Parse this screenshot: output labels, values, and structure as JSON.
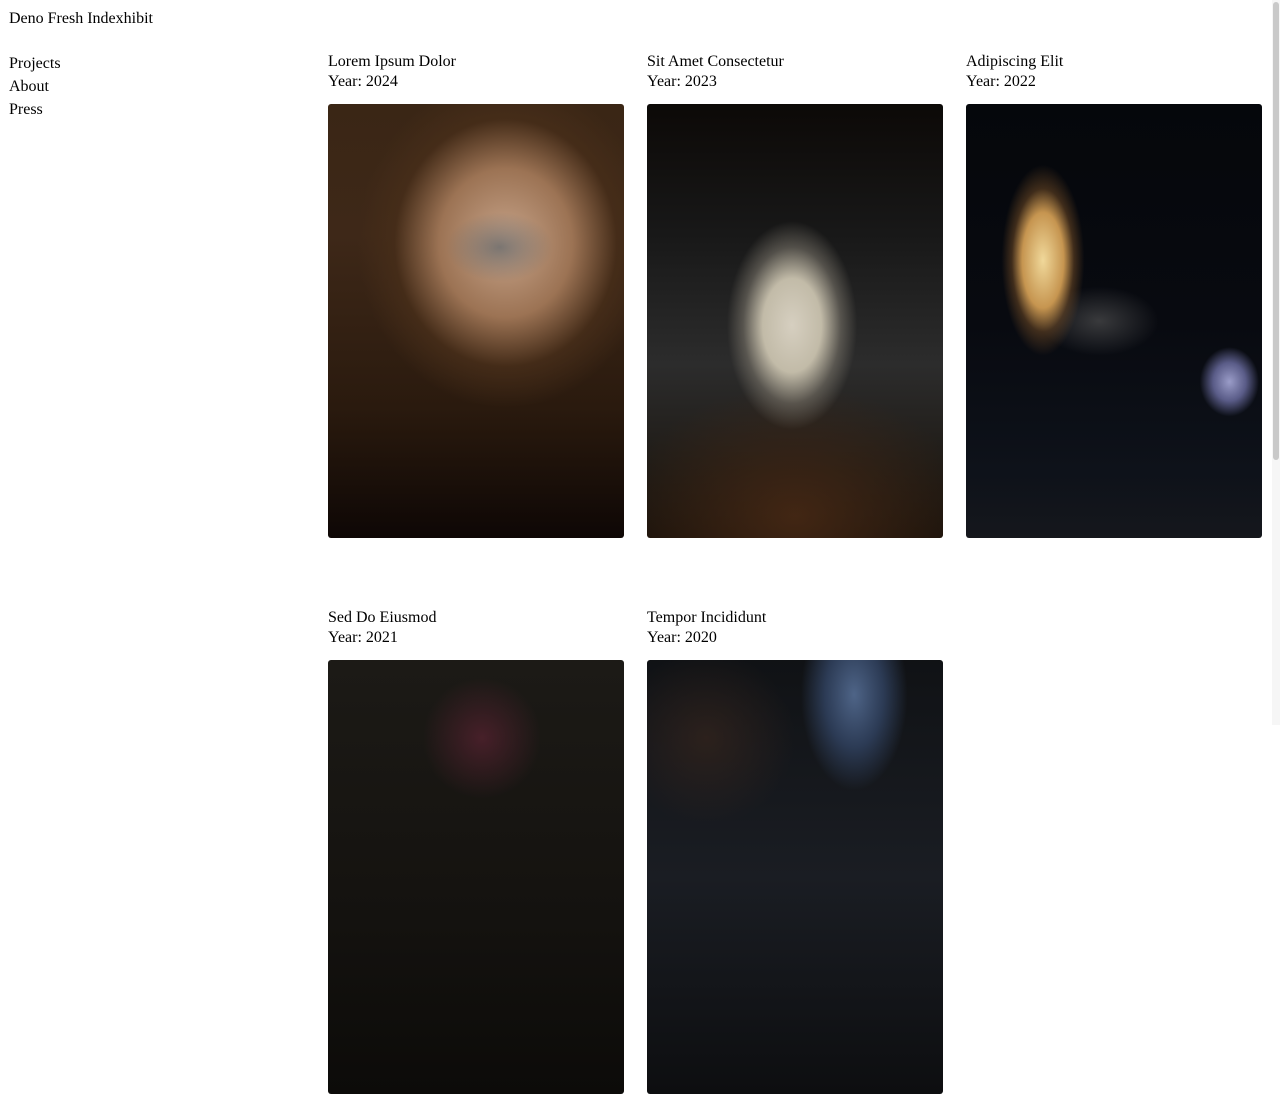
{
  "site": {
    "title": "Deno Fresh Indexhibit"
  },
  "nav": {
    "items": [
      {
        "label": "Projects"
      },
      {
        "label": "About"
      },
      {
        "label": "Press"
      }
    ]
  },
  "projects": [
    {
      "title": "Lorem Ipsum Dolor",
      "year": "Year: 2024"
    },
    {
      "title": "Sit Amet Consectetur",
      "year": "Year: 2023"
    },
    {
      "title": "Adipiscing Elit",
      "year": "Year: 2022"
    },
    {
      "title": "Sed Do Eiusmod",
      "year": "Year: 2021"
    },
    {
      "title": "Tempor Incididunt",
      "year": "Year: 2020"
    }
  ]
}
